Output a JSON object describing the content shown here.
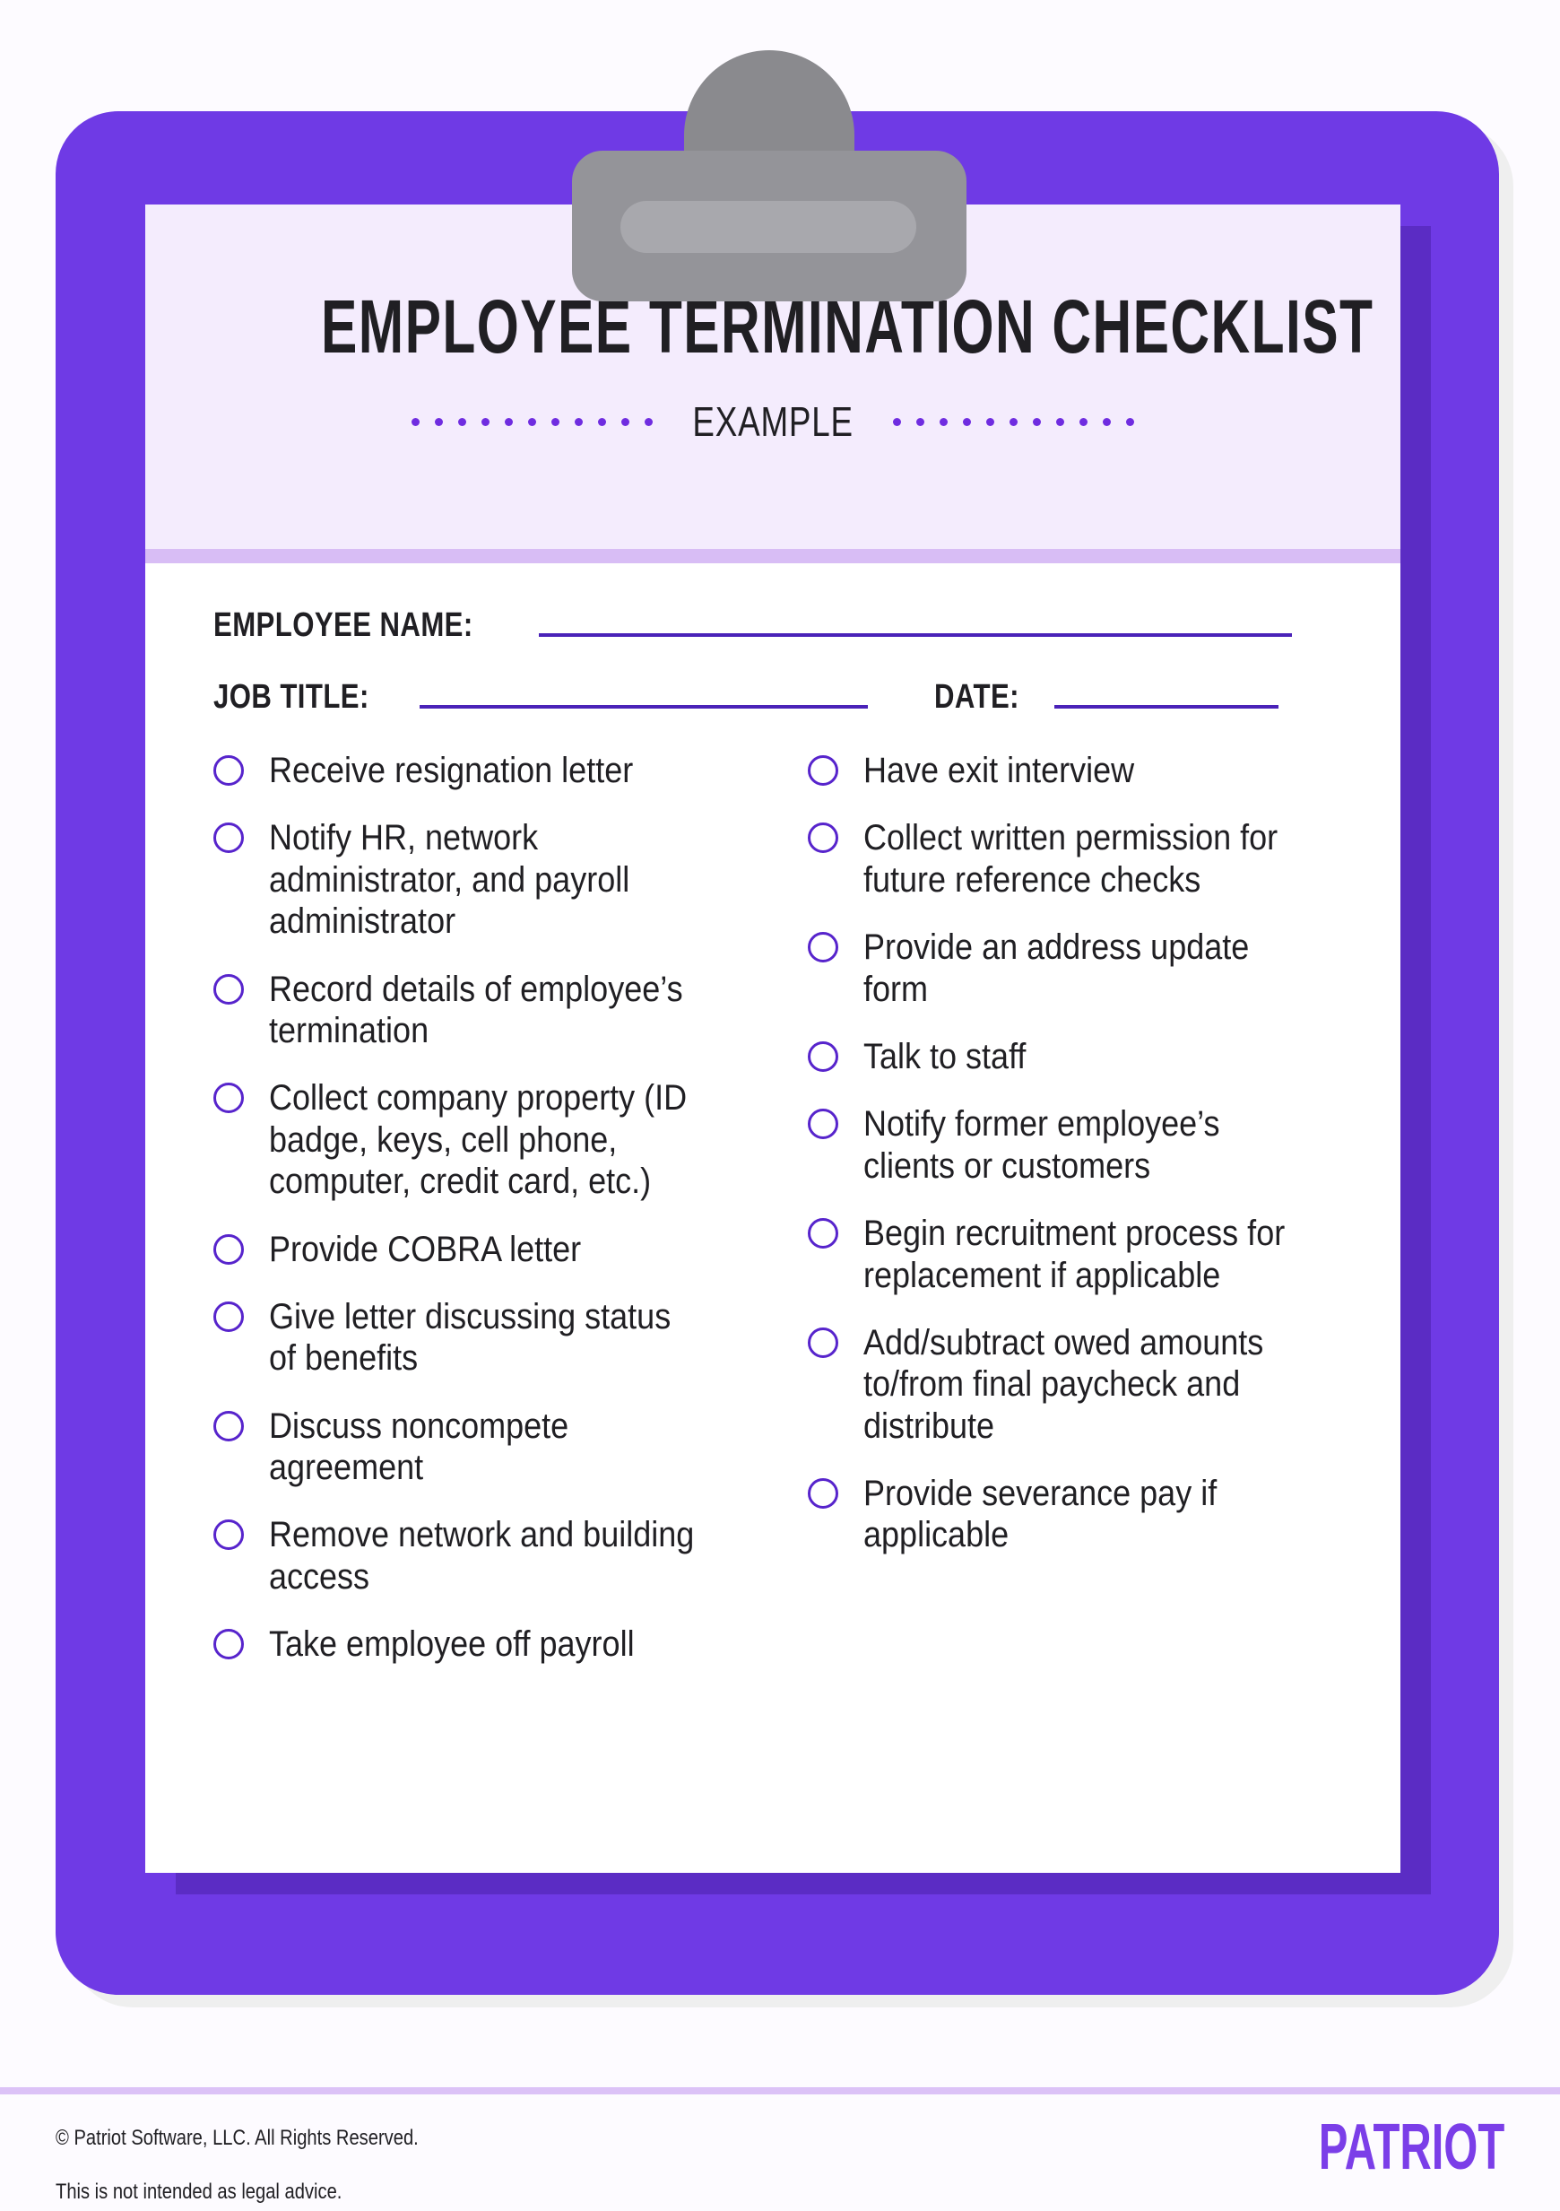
{
  "document": {
    "title": "EMPLOYEE TERMINATION CHECKLIST",
    "subtitle": "EXAMPLE",
    "dot_count": 11
  },
  "colors": {
    "clipboard_purple": "#6F3AE5",
    "paper_shadow_purple": "#5B2CC4",
    "header_band": "#F4ECFD",
    "header_rule": "#D8BDF5",
    "accent_line": "#4A22B8",
    "checkbox_outline": "#5724CC",
    "dot_purple": "#6F2CE0",
    "logo_purple": "#7B3EE8",
    "clip_gray": "#949499",
    "page_background": "#FDFBFF"
  },
  "form": {
    "fields": [
      {
        "label": "EMPLOYEE NAME:"
      },
      {
        "label": "JOB TITLE:"
      },
      {
        "label": "DATE:"
      }
    ]
  },
  "checklist": {
    "left_column": [
      "Receive resignation letter",
      "Notify HR, network administrator, and payroll administrator",
      "Record details of employee’s termination",
      "Collect company property (ID badge, keys, cell phone, computer, credit card, etc.)",
      "Provide COBRA letter",
      "Give letter discussing status of benefits",
      "Discuss noncompete agreement",
      "Remove network and building access",
      "Take employee off payroll"
    ],
    "right_column": [
      "Have exit interview",
      "Collect written permission for future reference checks",
      "Provide an address update form",
      "Talk to staff",
      "Notify former employee’s clients or customers",
      "Begin recruitment process for replacement if applicable",
      "Add/subtract owed amounts to/from final paycheck and distribute",
      "Provide severance pay if applicable"
    ]
  },
  "footer": {
    "copyright": "© Patriot Software, LLC. All Rights Reserved.",
    "disclaimer": "This is not intended as legal advice.",
    "logo": "PATRIOT"
  }
}
